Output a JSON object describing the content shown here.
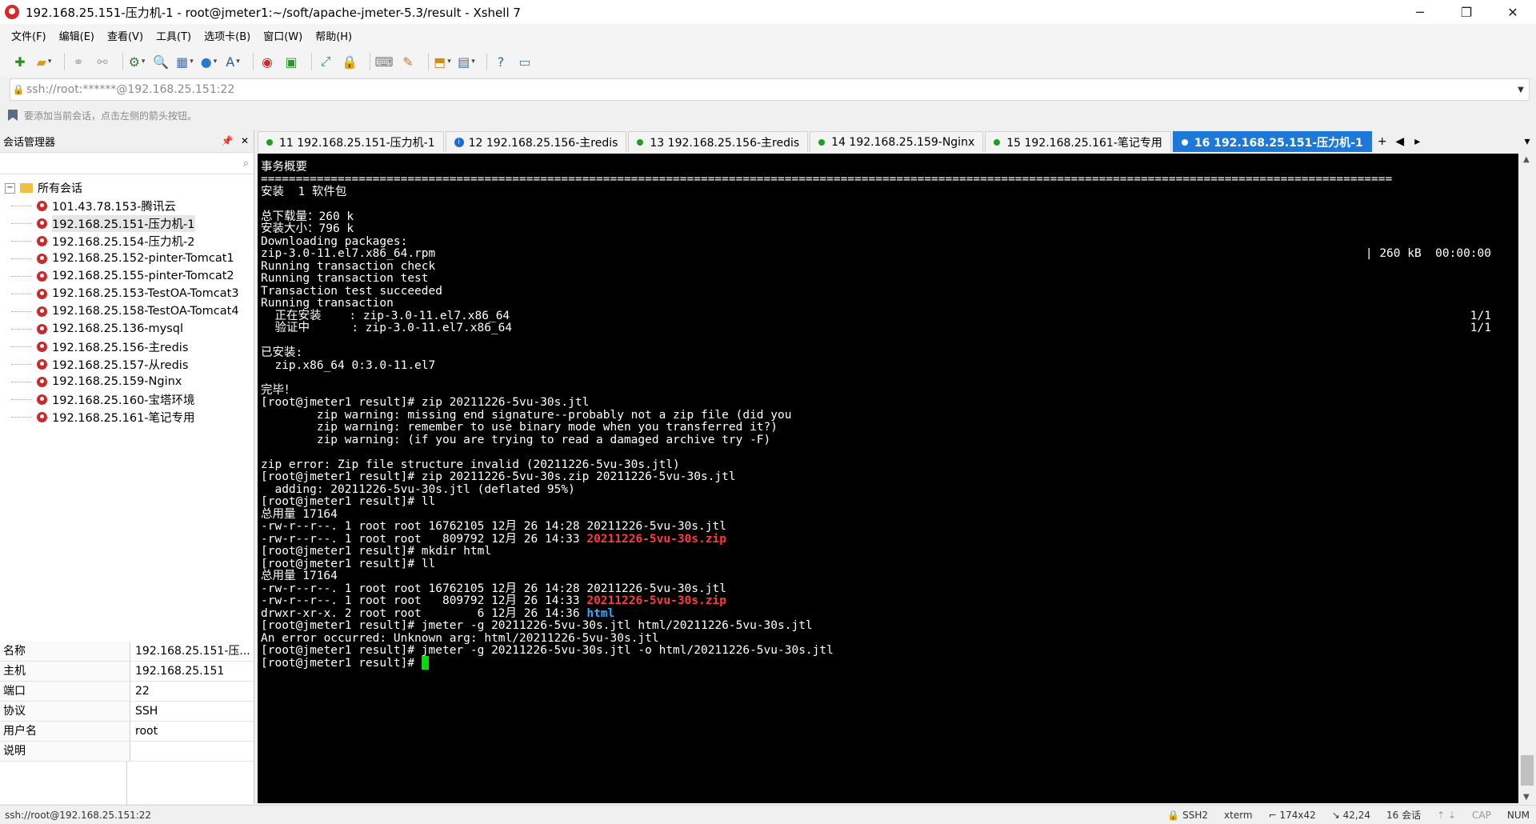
{
  "window": {
    "title": "192.168.25.151-压力机-1 - root@jmeter1:~/soft/apache-jmeter-5.3/result - Xshell 7",
    "minimize": "─",
    "maximize": "❐",
    "close": "✕"
  },
  "menu": [
    "文件(F)",
    "编辑(E)",
    "查看(V)",
    "工具(T)",
    "选项卡(B)",
    "窗口(W)",
    "帮助(H)"
  ],
  "address": {
    "value": "ssh://root:******@192.168.25.151:22",
    "hint": "要添加当前会话，点击左侧的箭头按钮。"
  },
  "sidebar": {
    "title": "会话管理器",
    "pin": "📌",
    "close": "✕",
    "root_label": "所有会话",
    "root_toggle": "−",
    "sessions": [
      "101.43.78.153-腾讯云",
      "192.168.25.151-压力机-1",
      "192.168.25.154-压力机-2",
      "192.168.25.152-pinter-Tomcat1",
      "192.168.25.155-pinter-Tomcat2",
      "192.168.25.153-TestOA-Tomcat3",
      "192.168.25.158-TestOA-Tomcat4",
      "192.168.25.136-mysql",
      "192.168.25.156-主redis",
      "192.168.25.157-从redis",
      "192.168.25.159-Nginx",
      "192.168.25.160-宝塔环境",
      "192.168.25.161-笔记专用"
    ],
    "selected_index": 1
  },
  "properties": [
    {
      "k": "名称",
      "v": "192.168.25.151-压..."
    },
    {
      "k": "主机",
      "v": "192.168.25.151"
    },
    {
      "k": "端口",
      "v": "22"
    },
    {
      "k": "协议",
      "v": "SSH"
    },
    {
      "k": "用户名",
      "v": "root"
    },
    {
      "k": "说明",
      "v": ""
    }
  ],
  "tabs": [
    {
      "label": "11 192.168.25.151-压力机-1",
      "status": "green"
    },
    {
      "label": "12 192.168.25.156-主redis",
      "status": "info"
    },
    {
      "label": "13 192.168.25.156-主redis",
      "status": "green"
    },
    {
      "label": "14 192.168.25.159-Nginx",
      "status": "green"
    },
    {
      "label": "15 192.168.25.161-笔记专用",
      "status": "green"
    },
    {
      "label": "16 192.168.25.151-压力机-1",
      "status": "active"
    }
  ],
  "terminal": {
    "lines": [
      [
        {
          "t": ""
        }
      ],
      [
        {
          "t": "事务概要"
        }
      ],
      [
        {
          "t": "=================================================================================================================================================================="
        }
      ],
      [
        {
          "t": "安装  1 软件包"
        }
      ],
      [
        {
          "t": ""
        }
      ],
      [
        {
          "t": "总下载量：260 k"
        }
      ],
      [
        {
          "t": "安装大小：796 k"
        }
      ],
      [
        {
          "t": "Downloading packages:"
        }
      ],
      [
        {
          "t": "zip-3.0-11.el7.x86_64.rpm"
        }
      ],
      [
        {
          "t": "Running transaction check"
        }
      ],
      [
        {
          "t": "Running transaction test"
        }
      ],
      [
        {
          "t": "Transaction test succeeded"
        }
      ],
      [
        {
          "t": "Running transaction"
        }
      ],
      [
        {
          "t": "  正在安装    : zip-3.0-11.el7.x86_64"
        }
      ],
      [
        {
          "t": "  验证中      : zip-3.0-11.el7.x86_64"
        }
      ],
      [
        {
          "t": ""
        }
      ],
      [
        {
          "t": "已安装:"
        }
      ],
      [
        {
          "t": "  zip.x86_64 0:3.0-11.el7"
        }
      ],
      [
        {
          "t": ""
        }
      ],
      [
        {
          "t": "完毕！"
        }
      ],
      [
        {
          "t": "[root@jmeter1 result]# zip 20211226-5vu-30s.jtl"
        }
      ],
      [
        {
          "t": "        zip warning: missing end signature--probably not a zip file (did you"
        }
      ],
      [
        {
          "t": "        zip warning: remember to use binary mode when you transferred it?)"
        }
      ],
      [
        {
          "t": "        zip warning: (if you are trying to read a damaged archive try -F)"
        }
      ],
      [
        {
          "t": ""
        }
      ],
      [
        {
          "t": "zip error: Zip file structure invalid (20211226-5vu-30s.jtl)"
        }
      ],
      [
        {
          "t": "[root@jmeter1 result]# zip 20211226-5vu-30s.zip 20211226-5vu-30s.jtl"
        }
      ],
      [
        {
          "t": "  adding: 20211226-5vu-30s.jtl (deflated 95%)"
        }
      ],
      [
        {
          "t": "[root@jmeter1 result]# ll"
        }
      ],
      [
        {
          "t": "总用量 17164"
        }
      ],
      [
        {
          "t": "-rw-r--r--. 1 root root 16762105 12月 26 14:28 20211226-5vu-30s.jtl"
        }
      ],
      [
        {
          "t": "-rw-r--r--. 1 root root   809792 12月 26 14:33 "
        },
        {
          "t": "20211226-5vu-30s.zip",
          "c": "red"
        }
      ],
      [
        {
          "t": "[root@jmeter1 result]# mkdir html"
        }
      ],
      [
        {
          "t": "[root@jmeter1 result]# ll"
        }
      ],
      [
        {
          "t": "总用量 17164"
        }
      ],
      [
        {
          "t": "-rw-r--r--. 1 root root 16762105 12月 26 14:28 20211226-5vu-30s.jtl"
        }
      ],
      [
        {
          "t": "-rw-r--r--. 1 root root   809792 12月 26 14:33 "
        },
        {
          "t": "20211226-5vu-30s.zip",
          "c": "red"
        }
      ],
      [
        {
          "t": "drwxr-xr-x. 2 root root        6 12月 26 14:36 "
        },
        {
          "t": "html",
          "c": "blue"
        }
      ],
      [
        {
          "t": "[root@jmeter1 result]# jmeter -g 20211226-5vu-30s.jtl html/20211226-5vu-30s.jtl"
        }
      ],
      [
        {
          "t": "An error occurred: Unknown arg: html/20211226-5vu-30s.jtl"
        }
      ],
      [
        {
          "t": "[root@jmeter1 result]# jmeter -g 20211226-5vu-30s.jtl -o html/20211226-5vu-30s.jtl"
        }
      ],
      [
        {
          "t": "[root@jmeter1 result]# "
        },
        {
          "cursor": true
        }
      ]
    ],
    "right_texts": [
      {
        "line": 8,
        "t": "| 260 kB  00:00:00"
      },
      {
        "line": 13,
        "t": "1/1"
      },
      {
        "line": 14,
        "t": "1/1"
      }
    ]
  },
  "status": {
    "connection": "ssh://root@192.168.25.151:22",
    "protocol": "SSH2",
    "term": "xterm",
    "size": "174x42",
    "pos": "42,24",
    "sessions": "16 会话",
    "caps": "CAP",
    "num": "NUM"
  }
}
